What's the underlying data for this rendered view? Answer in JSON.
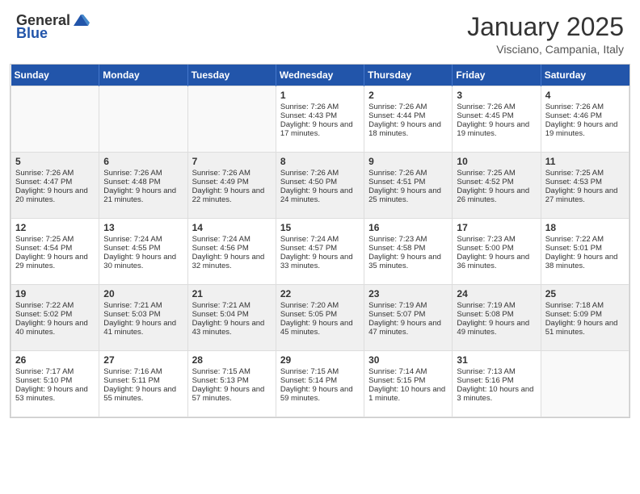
{
  "logo": {
    "general": "General",
    "blue": "Blue"
  },
  "header": {
    "month": "January 2025",
    "location": "Visciano, Campania, Italy"
  },
  "days": [
    "Sunday",
    "Monday",
    "Tuesday",
    "Wednesday",
    "Thursday",
    "Friday",
    "Saturday"
  ],
  "weeks": [
    [
      {
        "day": "",
        "empty": true
      },
      {
        "day": "",
        "empty": true
      },
      {
        "day": "",
        "empty": true
      },
      {
        "day": "1",
        "sunrise": "7:26 AM",
        "sunset": "4:43 PM",
        "daylight": "9 hours and 17 minutes."
      },
      {
        "day": "2",
        "sunrise": "7:26 AM",
        "sunset": "4:44 PM",
        "daylight": "9 hours and 18 minutes."
      },
      {
        "day": "3",
        "sunrise": "7:26 AM",
        "sunset": "4:45 PM",
        "daylight": "9 hours and 19 minutes."
      },
      {
        "day": "4",
        "sunrise": "7:26 AM",
        "sunset": "4:46 PM",
        "daylight": "9 hours and 19 minutes."
      }
    ],
    [
      {
        "day": "5",
        "sunrise": "7:26 AM",
        "sunset": "4:47 PM",
        "daylight": "9 hours and 20 minutes."
      },
      {
        "day": "6",
        "sunrise": "7:26 AM",
        "sunset": "4:48 PM",
        "daylight": "9 hours and 21 minutes."
      },
      {
        "day": "7",
        "sunrise": "7:26 AM",
        "sunset": "4:49 PM",
        "daylight": "9 hours and 22 minutes."
      },
      {
        "day": "8",
        "sunrise": "7:26 AM",
        "sunset": "4:50 PM",
        "daylight": "9 hours and 24 minutes."
      },
      {
        "day": "9",
        "sunrise": "7:26 AM",
        "sunset": "4:51 PM",
        "daylight": "9 hours and 25 minutes."
      },
      {
        "day": "10",
        "sunrise": "7:25 AM",
        "sunset": "4:52 PM",
        "daylight": "9 hours and 26 minutes."
      },
      {
        "day": "11",
        "sunrise": "7:25 AM",
        "sunset": "4:53 PM",
        "daylight": "9 hours and 27 minutes."
      }
    ],
    [
      {
        "day": "12",
        "sunrise": "7:25 AM",
        "sunset": "4:54 PM",
        "daylight": "9 hours and 29 minutes."
      },
      {
        "day": "13",
        "sunrise": "7:24 AM",
        "sunset": "4:55 PM",
        "daylight": "9 hours and 30 minutes."
      },
      {
        "day": "14",
        "sunrise": "7:24 AM",
        "sunset": "4:56 PM",
        "daylight": "9 hours and 32 minutes."
      },
      {
        "day": "15",
        "sunrise": "7:24 AM",
        "sunset": "4:57 PM",
        "daylight": "9 hours and 33 minutes."
      },
      {
        "day": "16",
        "sunrise": "7:23 AM",
        "sunset": "4:58 PM",
        "daylight": "9 hours and 35 minutes."
      },
      {
        "day": "17",
        "sunrise": "7:23 AM",
        "sunset": "5:00 PM",
        "daylight": "9 hours and 36 minutes."
      },
      {
        "day": "18",
        "sunrise": "7:22 AM",
        "sunset": "5:01 PM",
        "daylight": "9 hours and 38 minutes."
      }
    ],
    [
      {
        "day": "19",
        "sunrise": "7:22 AM",
        "sunset": "5:02 PM",
        "daylight": "9 hours and 40 minutes."
      },
      {
        "day": "20",
        "sunrise": "7:21 AM",
        "sunset": "5:03 PM",
        "daylight": "9 hours and 41 minutes."
      },
      {
        "day": "21",
        "sunrise": "7:21 AM",
        "sunset": "5:04 PM",
        "daylight": "9 hours and 43 minutes."
      },
      {
        "day": "22",
        "sunrise": "7:20 AM",
        "sunset": "5:05 PM",
        "daylight": "9 hours and 45 minutes."
      },
      {
        "day": "23",
        "sunrise": "7:19 AM",
        "sunset": "5:07 PM",
        "daylight": "9 hours and 47 minutes."
      },
      {
        "day": "24",
        "sunrise": "7:19 AM",
        "sunset": "5:08 PM",
        "daylight": "9 hours and 49 minutes."
      },
      {
        "day": "25",
        "sunrise": "7:18 AM",
        "sunset": "5:09 PM",
        "daylight": "9 hours and 51 minutes."
      }
    ],
    [
      {
        "day": "26",
        "sunrise": "7:17 AM",
        "sunset": "5:10 PM",
        "daylight": "9 hours and 53 minutes."
      },
      {
        "day": "27",
        "sunrise": "7:16 AM",
        "sunset": "5:11 PM",
        "daylight": "9 hours and 55 minutes."
      },
      {
        "day": "28",
        "sunrise": "7:15 AM",
        "sunset": "5:13 PM",
        "daylight": "9 hours and 57 minutes."
      },
      {
        "day": "29",
        "sunrise": "7:15 AM",
        "sunset": "5:14 PM",
        "daylight": "9 hours and 59 minutes."
      },
      {
        "day": "30",
        "sunrise": "7:14 AM",
        "sunset": "5:15 PM",
        "daylight": "10 hours and 1 minute."
      },
      {
        "day": "31",
        "sunrise": "7:13 AM",
        "sunset": "5:16 PM",
        "daylight": "10 hours and 3 minutes."
      },
      {
        "day": "",
        "empty": true
      }
    ]
  ]
}
